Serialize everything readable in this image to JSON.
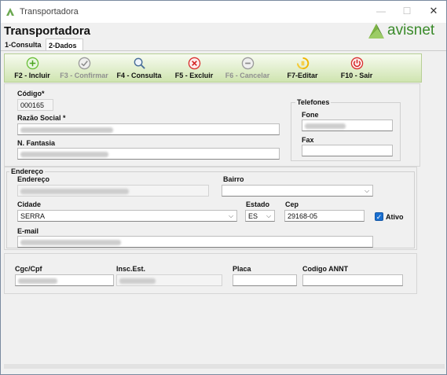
{
  "window": {
    "title": "Transportadora",
    "controls": {
      "minimize": "—",
      "maximize": "☐",
      "close": "✕"
    }
  },
  "header": {
    "page_title": "Transportadora",
    "logo_text": "avisnet"
  },
  "tabs": [
    {
      "label": "1-Consulta"
    },
    {
      "label": "2-Dados"
    }
  ],
  "toolbar": {
    "buttons": [
      {
        "label": "F2 - Incluir",
        "icon": "add-icon"
      },
      {
        "label": "F3 - Confirmar",
        "icon": "check-icon"
      },
      {
        "label": "F4 - Consulta",
        "icon": "search-icon"
      },
      {
        "label": "F5 - Excluir",
        "icon": "delete-icon"
      },
      {
        "label": "F6 - Cancelar",
        "icon": "cancel-icon"
      },
      {
        "label": "F7-Editar",
        "icon": "edit-icon"
      },
      {
        "label": "F10 - Sair",
        "icon": "power-icon"
      }
    ]
  },
  "form": {
    "codigo_label": "Código*",
    "codigo_value": "000165",
    "razao_label": "Razão Social *",
    "fantasia_label": "N. Fantasia",
    "telefones_title": "Telefones",
    "fone_label": "Fone",
    "fax_label": "Fax",
    "endereco_group": "Endereço",
    "endereco_label": "Endereço",
    "bairro_label": "Bairro",
    "cidade_label": "Cidade",
    "cidade_value": "SERRA",
    "estado_label": "Estado",
    "estado_value": "ES",
    "cep_label": "Cep",
    "cep_value": "29168-05",
    "ativo_label": "Ativo",
    "email_label": "E-mail",
    "cgc_label": "Cgc/Cpf",
    "insc_label": "Insc.Est.",
    "placa_label": "Placa",
    "antt_label": "Codigo ANNT"
  },
  "colors": {
    "toolbar_top": "#f7fbf0",
    "toolbar_bottom": "#cfe4b0",
    "brand_green": "#3a8a2a",
    "checkbox_blue": "#1a6fd0"
  }
}
